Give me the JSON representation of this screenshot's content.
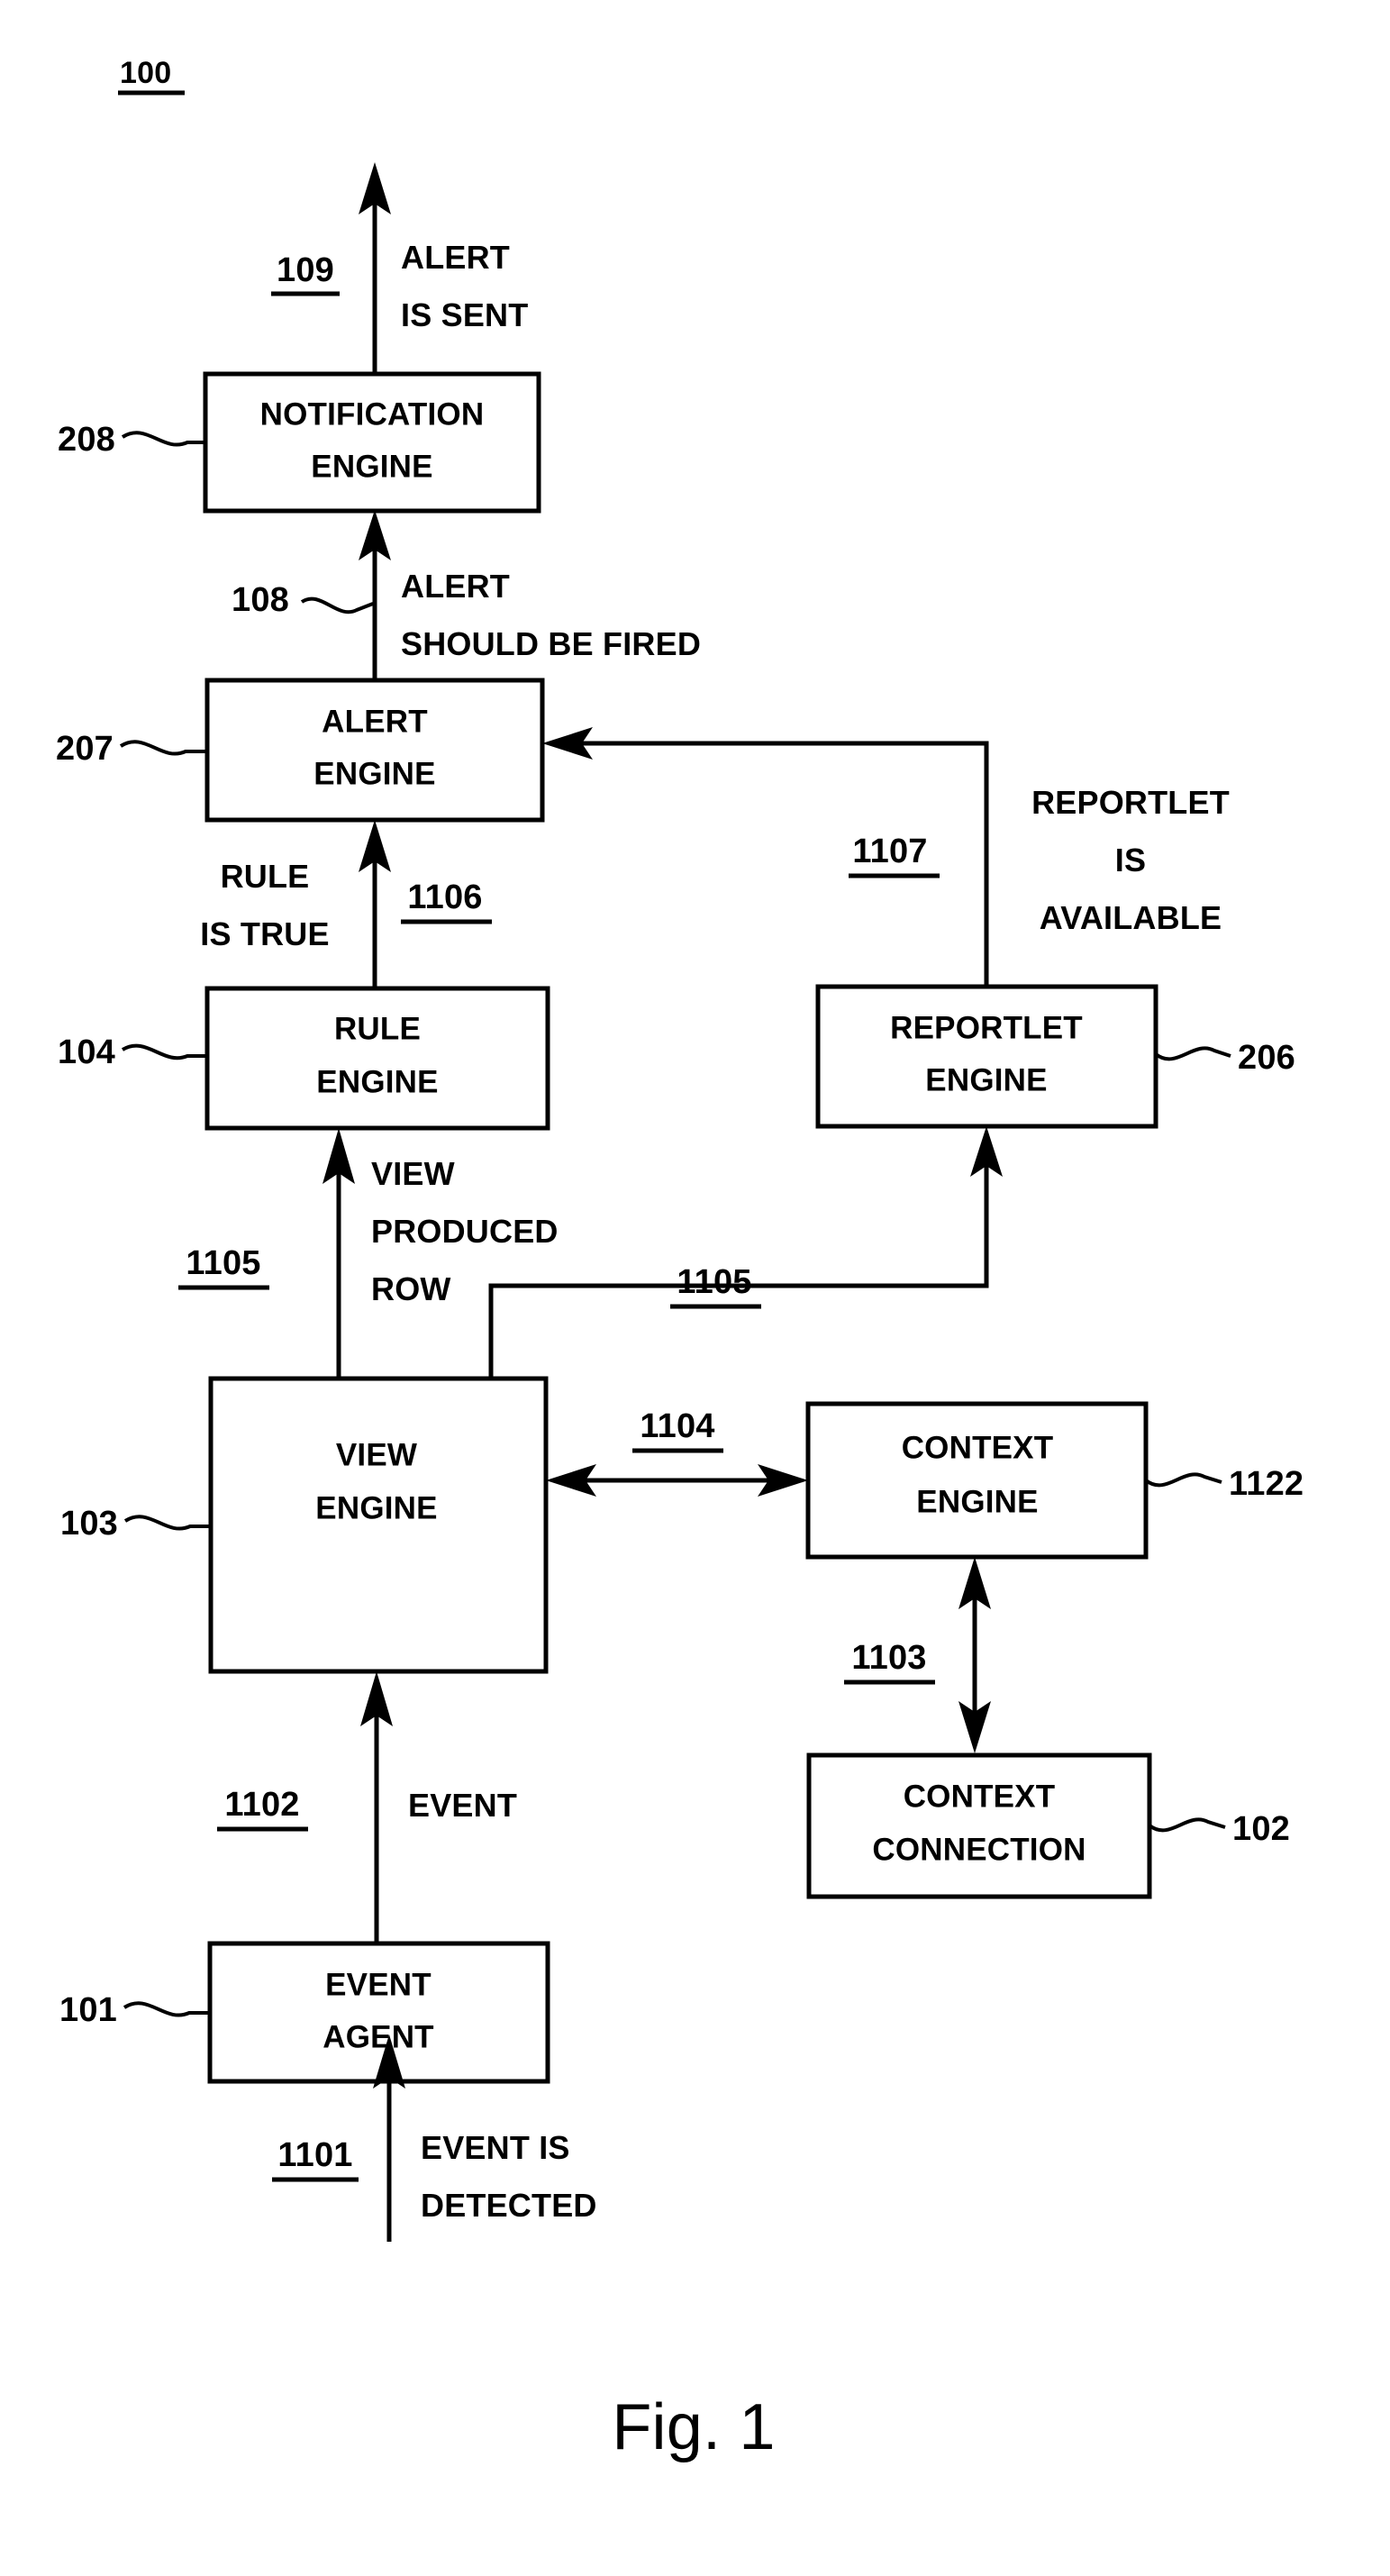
{
  "figure": {
    "number_label": "100",
    "caption": "Fig. 1"
  },
  "boxes": [
    {
      "id": "notification-engine",
      "ref": "208",
      "line1": "NOTIFICATION",
      "line2": "ENGINE"
    },
    {
      "id": "alert-engine",
      "ref": "207",
      "line1": "ALERT",
      "line2": "ENGINE"
    },
    {
      "id": "rule-engine",
      "ref": "104",
      "line1": "RULE",
      "line2": "ENGINE"
    },
    {
      "id": "reportlet-engine",
      "ref": "206",
      "line1": "REPORTLET",
      "line2": "ENGINE"
    },
    {
      "id": "view-engine",
      "ref": "103",
      "line1": "VIEW",
      "line2": "ENGINE"
    },
    {
      "id": "context-engine",
      "ref": "1122",
      "line1": "CONTEXT",
      "line2": "ENGINE"
    },
    {
      "id": "context-connection",
      "ref": "102",
      "line1": "CONTEXT",
      "line2": "CONNECTION"
    },
    {
      "id": "event-agent",
      "ref": "101",
      "line1": "EVENT",
      "line2": "AGENT"
    }
  ],
  "flows": [
    {
      "id": "alert-is-sent",
      "ref": "109",
      "ref_underlined": true,
      "line1": "ALERT",
      "line2": "IS SENT",
      "line3": ""
    },
    {
      "id": "alert-should-be-fired",
      "ref": "108",
      "ref_underlined": false,
      "line1": "ALERT",
      "line2": "SHOULD BE FIRED",
      "line3": ""
    },
    {
      "id": "rule-is-true",
      "ref": "1106",
      "ref_underlined": true,
      "line1": "RULE",
      "line2": "IS TRUE",
      "line3": ""
    },
    {
      "id": "reportlet-is-available",
      "ref": "1107",
      "ref_underlined": true,
      "line1": "REPORTLET",
      "line2": "IS",
      "line3": "AVAILABLE"
    },
    {
      "id": "view-produced-row",
      "ref": "1105",
      "ref_underlined": true,
      "line1": "VIEW",
      "line2": "PRODUCED",
      "line3": "ROW"
    },
    {
      "id": "view-to-reportlet",
      "ref": "1105",
      "ref_underlined": true,
      "line1": "",
      "line2": "",
      "line3": ""
    },
    {
      "id": "view-context",
      "ref": "1104",
      "ref_underlined": true,
      "line1": "",
      "line2": "",
      "line3": ""
    },
    {
      "id": "context-connection-link",
      "ref": "1103",
      "ref_underlined": true,
      "line1": "",
      "line2": "",
      "line3": ""
    },
    {
      "id": "event",
      "ref": "1102",
      "ref_underlined": true,
      "line1": "EVENT",
      "line2": "",
      "line3": ""
    },
    {
      "id": "event-is-detected",
      "ref": "1101",
      "ref_underlined": true,
      "line1": "EVENT IS",
      "line2": "DETECTED",
      "line3": ""
    }
  ],
  "colors": {
    "ink": "#000000",
    "paper": "#ffffff"
  }
}
